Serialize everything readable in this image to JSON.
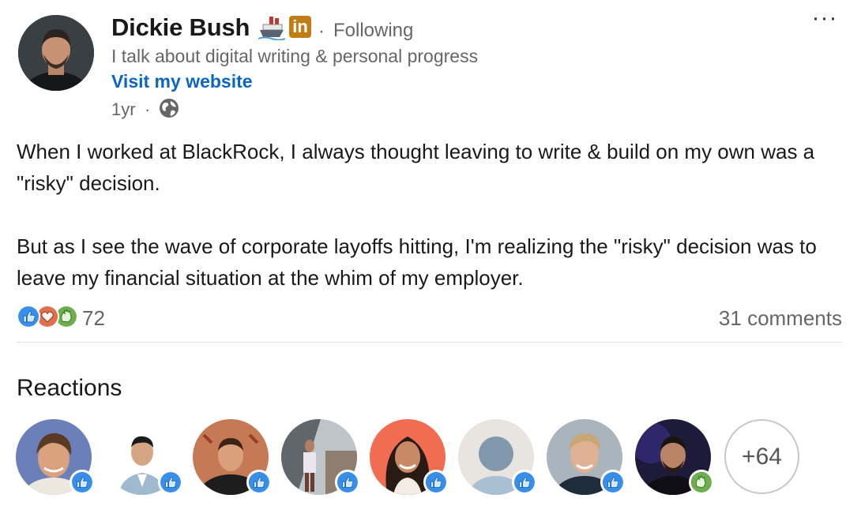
{
  "author": {
    "name": "Dickie Bush",
    "badge_in": "in",
    "follow_status": "Following",
    "headline": "I talk about digital writing & personal progress",
    "website_label": "Visit my website",
    "timestamp": "1yr"
  },
  "post": {
    "paragraphs": [
      "When I worked at BlackRock, I always thought leaving to write & build on my own was a \"risky\" decision.",
      "But as I see the wave of corporate layoffs hitting, I'm realizing the \"risky\" decision was to leave my financial situation at the whim of my employer."
    ]
  },
  "social": {
    "reaction_count": "72",
    "comments": "31 comments",
    "reaction_types": [
      "like",
      "love",
      "celebrate"
    ]
  },
  "reactions": {
    "title": "Reactions",
    "more": "+64",
    "people": [
      {
        "reaction": "like",
        "bg": "#6b7fb8"
      },
      {
        "reaction": "like",
        "bg": "#ffffff"
      },
      {
        "reaction": "like",
        "bg": "#c57a55"
      },
      {
        "reaction": "like",
        "bg": "#9aa0a6"
      },
      {
        "reaction": "like",
        "bg": "#f06d52"
      },
      {
        "reaction": "like",
        "bg": "#e8e4df"
      },
      {
        "reaction": "like",
        "bg": "#a9b4bc"
      },
      {
        "reaction": "celebrate",
        "bg": "#1d1a3a"
      }
    ]
  },
  "colors": {
    "link": "#0a66c2",
    "like": "#378fe9",
    "love": "#df704d",
    "celebrate": "#6dae4f",
    "muted_text": "#666666"
  },
  "icons": [
    "ship-icon",
    "linkedin-in-icon",
    "globe-icon",
    "more-options-icon",
    "like-icon",
    "love-icon",
    "celebrate-icon"
  ]
}
